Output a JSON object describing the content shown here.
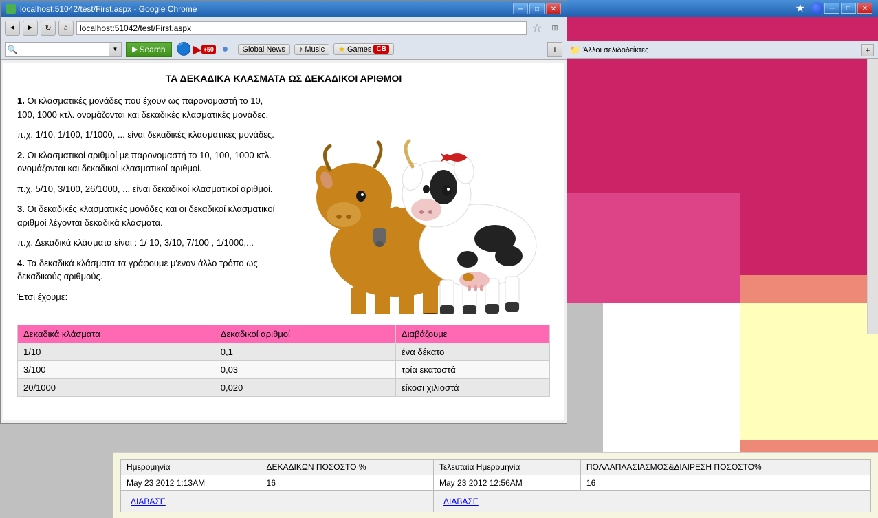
{
  "window": {
    "title": "localhost:51042/test/First.aspx - Google Chrome",
    "url": "localhost:51042/test/First.aspx"
  },
  "toolbar": {
    "search_placeholder": "",
    "search_label": "Search",
    "search_dropdown": "▼",
    "global_news": "Global News",
    "music": "Music",
    "games": "Games"
  },
  "page": {
    "title": "ΤΑ ΔΕΚΑΔΙΚΑ ΚΛΑΣΜΑΤΑ ΩΣ ΔΕΚΑΔΙΚΟΙ ΑΡΙΘΜΟΙ",
    "section1_num": "1.",
    "section1_text": "Οι κλασματικές μονάδες που έχουν ως παρονομαστή το 10, 100, 1000 κτλ. ονομάζονται και δεκαδικές κλασματικές μονάδες.",
    "section1_example": "π.χ. 1/10, 1/100, 1/1000, ... είναι δεκαδικές κλασματικές μονάδες.",
    "section2_num": "2.",
    "section2_text": "Οι κλασματικοί αριθμοί με παρονομαστή το 10, 100, 1000 κτλ. ονομάζονται και δεκαδικοί κλασματικοί αριθμοί.",
    "section2_example": "π.χ. 5/10, 3/100, 26/1000, ... είναι δεκαδικοί κλασματικοί αριθμοί.",
    "section3_num": "3.",
    "section3_text": "Οι δεκαδικές κλασματικές μονάδες και οι δεκαδικοί κλασματικοί αριθμοί λέγονται δεκαδικά κλάσματα.",
    "section3_example": "π.χ. Δεκαδικά κλάσματα είναι : 1/ 10, 3/10, 7/100 , 1/1000,...",
    "section4_num": "4.",
    "section4_text": "Τα δεκαδικά κλάσματα τα γράφουμε μ'εναν άλλο τρόπο ως δεκαδικούς αριθμούς.",
    "section4_text2": "Έτσι έχουμε:"
  },
  "table": {
    "headers": [
      "Δεκαδικά κλάσματα",
      "Δεκαδικοί αριθμοί",
      "Διαβάζουμε"
    ],
    "rows": [
      [
        "1/10",
        "0,1",
        "ένα δέκατο"
      ],
      [
        "3/100",
        "0,03",
        "τρία εκατοστά"
      ],
      [
        "20/1000",
        "0,020",
        "είκοσι χιλιοστά"
      ]
    ]
  },
  "bottom": {
    "col1_header": "Ημερομηνία",
    "col2_header": "ΔΕΚΑΔΙΚΩΝ ΠΟΣΟΣΤΟ %",
    "col3_header": "Τελευταία Ημερομηνία",
    "col4_header": "ΠΟΛΛΑΠΛΑΣΙΑΣΜΟΣ&ΔΙΑΙΡΕΣΗ ΠΟΣΟΣΤΟ%",
    "row1_date": "May 23 2012 1:13AM",
    "row1_val": "16",
    "row1_date2": "May 23 2012 12:56AM",
    "row1_val2": "16",
    "btn1_label": "ΔΙΑΒΑΣΕ",
    "btn2_label": "ΔΙΑΒΑΣΕ"
  },
  "right_panel": {
    "bookmarks_label": "Άλλοι σελιδοδείκτες",
    "add_btn": "+"
  },
  "icons": {
    "search": "🔍",
    "back": "◄",
    "forward": "►",
    "refresh": "↻",
    "home": "⌂",
    "star": "★",
    "minimize": "─",
    "maximize": "□",
    "close": "✕",
    "youtube": "+50",
    "globe": "🌐",
    "music_note": "♪",
    "games_star": "★",
    "folder": "📁"
  }
}
